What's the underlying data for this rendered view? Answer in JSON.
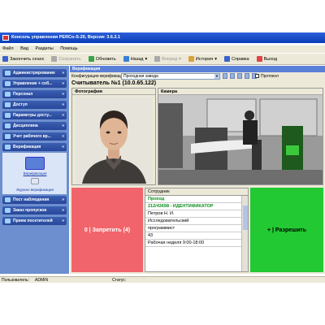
{
  "window": {
    "title": "Консоль управления PERCo-S-20, Версия: 3.6.2.1"
  },
  "menu": [
    "Файл",
    "Вид",
    "Разделы",
    "Помощь"
  ],
  "toolbar": {
    "end_session": "Закончить сеанс",
    "save": "Сохранить",
    "refresh": "Обновить",
    "back": "Назад",
    "forward": "Вперед",
    "history": "История",
    "help": "Справка",
    "exit": "Выход"
  },
  "sidebar": {
    "items": [
      {
        "label": "Администрирование",
        "icon": "admin-icon"
      },
      {
        "label": "Управление + соб...",
        "icon": "control-icon"
      },
      {
        "label": "Персонал",
        "icon": "staff-icon"
      },
      {
        "label": "Доступ",
        "icon": "access-icon"
      },
      {
        "label": "Параметры досту...",
        "icon": "params-icon"
      },
      {
        "label": "Дисциплина",
        "icon": "discipline-icon"
      },
      {
        "label": "Учет рабочего вр...",
        "icon": "timesheet-icon"
      },
      {
        "label": "Верификация",
        "icon": "verification-icon"
      }
    ],
    "sub_items": [
      "Верификация",
      "Журнал верификации"
    ],
    "bottom_items": [
      {
        "label": "Пост наблюдения",
        "icon": "watch-post-icon"
      },
      {
        "label": "Заказ пропусков",
        "icon": "pass-order-icon"
      },
      {
        "label": "Прием посетителей",
        "icon": "visitors-icon"
      }
    ]
  },
  "content": {
    "title": "Верификация",
    "config_label": "Конфигурация верификации:",
    "config_value": "Проходная завода",
    "protocol_label": "Протокол",
    "reader": "Считыватель №1 (10.0.65.122)",
    "photo_label": "Фотография",
    "camera_label": "Камера"
  },
  "deny": {
    "label": "0 | Запретить (4)"
  },
  "employee": {
    "header": "Сотрудник",
    "rows": [
      {
        "text": "Проход",
        "green": true
      },
      {
        "text": "212/43698 - ИДЕНТИФИКАТОР",
        "green": true
      },
      {
        "text": "Петров Н. И.",
        "green": false
      },
      {
        "text": "Исследовательский",
        "green": false
      },
      {
        "text": "программист",
        "green": false
      },
      {
        "text": "43",
        "green": false
      },
      {
        "text": "Рабочая неделя 9:00-18:00",
        "green": false
      }
    ]
  },
  "allow": {
    "label": "+ | Разрешить"
  },
  "status": {
    "user_label": "Пользователь:",
    "user_value": "ADMIN",
    "status_label": "Статус:"
  },
  "colors": {
    "deny": "#f2646b",
    "allow": "#22c932",
    "sidebar": "#6d8fcf",
    "accent": "#0a3db8"
  }
}
